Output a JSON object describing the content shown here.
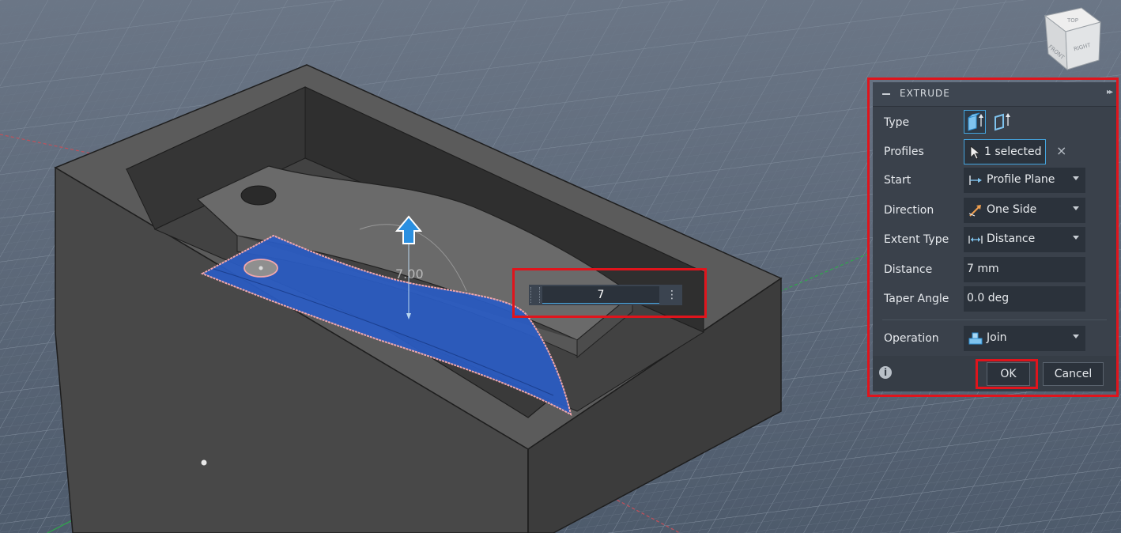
{
  "viewport": {
    "dimension_label": "7.00",
    "inline_input_value": "7",
    "viewcube_faces": [
      "TOP",
      "FRONT",
      "RIGHT"
    ]
  },
  "panel": {
    "title": "EXTRUDE",
    "rows": {
      "type": {
        "label": "Type"
      },
      "profiles": {
        "label": "Profiles",
        "value": "1 selected"
      },
      "start": {
        "label": "Start",
        "value": "Profile Plane"
      },
      "direction": {
        "label": "Direction",
        "value": "One Side"
      },
      "extent_type": {
        "label": "Extent Type",
        "value": "Distance"
      },
      "distance": {
        "label": "Distance",
        "value": "7 mm"
      },
      "taper_angle": {
        "label": "Taper Angle",
        "value": "0.0 deg"
      },
      "operation": {
        "label": "Operation",
        "value": "Join"
      }
    },
    "ok_label": "OK",
    "cancel_label": "Cancel",
    "info_glyph": "i"
  },
  "colors": {
    "accent": "#44a5df",
    "annotation": "#e0141c",
    "profile_fill": "#2a5cc4",
    "body_gray": "#4b4b4b"
  }
}
